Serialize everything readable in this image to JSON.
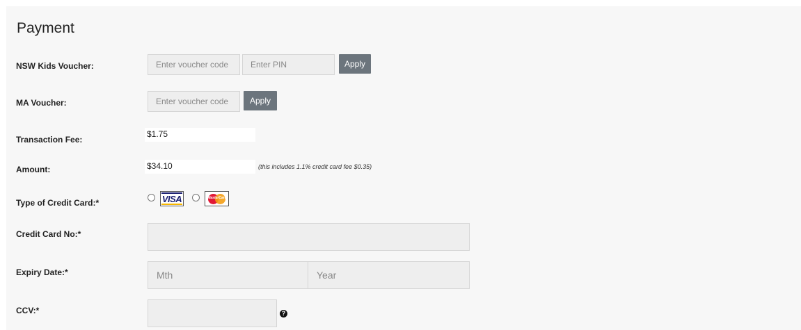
{
  "title": "Payment",
  "nsw_kids": {
    "label": "NSW Kids Voucher:",
    "code_placeholder": "Enter voucher code",
    "pin_placeholder": "Enter PIN",
    "apply_label": "Apply"
  },
  "ma_voucher": {
    "label": "MA Voucher:",
    "code_placeholder": "Enter voucher code",
    "apply_label": "Apply"
  },
  "transaction_fee": {
    "label": "Transaction Fee:",
    "value": "$1.75"
  },
  "amount": {
    "label": "Amount:",
    "value": "$34.10",
    "note": "(this includes 1.1% credit card fee $0.35)"
  },
  "card_type": {
    "label": "Type of Credit Card:*",
    "options": [
      {
        "name": "Visa",
        "logo_text": "VISA",
        "selected": false
      },
      {
        "name": "MasterCard",
        "logo_text": "MasterCard",
        "selected": false
      }
    ]
  },
  "card_number": {
    "label": "Credit Card No:*",
    "value": ""
  },
  "expiry": {
    "label": "Expiry Date:*",
    "month_placeholder": "Mth",
    "year_placeholder": "Year"
  },
  "ccv": {
    "label": "CCV:*",
    "value": "",
    "help_icon": "question-circle-icon",
    "help_glyph": "?"
  },
  "colors": {
    "panel_bg": "#f7f7f7",
    "field_bg": "#eeeeee",
    "button_bg": "#6c757d"
  }
}
